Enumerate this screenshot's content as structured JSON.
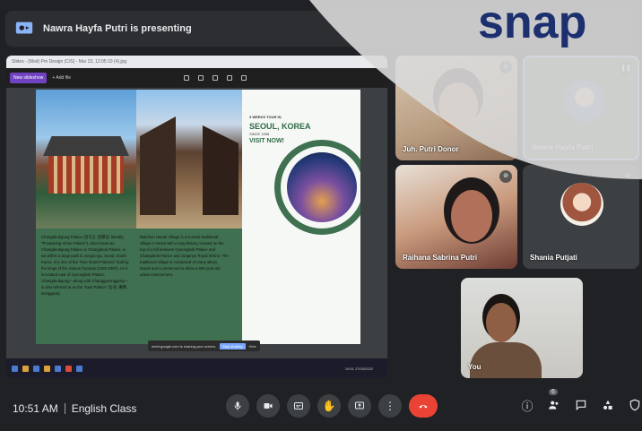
{
  "presenting_bar": {
    "text": "Nawra Hayfa Putri is presenting"
  },
  "shared_screen": {
    "window_title": "Slides - (Mod) Pro Design (C/S) - Mar 23, 12:05:10 (4).jpg",
    "toolbar_tab": "New slideshow",
    "toolbar_item": "+ Add file",
    "brochure": {
      "small_header": "3 WEEKS TOUR IN",
      "title": "SEOUL, KOREA",
      "subtitle": "SINCE 1998",
      "cta": "VISIT NOW!",
      "col1_text": "Changdeokgung Palace (창덕궁, 昌德宮; literally: \"Prospering Virtue Palace\"), also known as Changdeokgung Palace or Changdeok Palace, is set within a large park in Jongno-gu, Seoul, South Korea. It is one of the \"Five Grand Palaces\" built by the kings of the Joseon Dynasty (1392-1897). As it is located east of Gyeongbok Palace, Changdeokgung—along with Changgyeonggung—is also referred to as the \"East Palace\" (동궐, 東闕, Donggwol).",
      "col2_text": "Bukchon Hanok Village is a Korean traditional village in Seoul with a long history, located on the top of a hill between Gyeongbok Palace and Changdeok Palace and Jongmyo Royal Shrine. The traditional village is composed of many alleys, hanok and is preserved to show a 600-year-old urban environment."
    },
    "notice_text": "meet.google.com is sharing your screen.",
    "notice_stop": "Stop sharing",
    "notice_hide": "Hide",
    "taskbar_clock": "10:51 27/03/2022"
  },
  "participants": [
    {
      "name": "Juh. Putri Donor",
      "muted": true
    },
    {
      "name": "Nawra Hayfa Putri",
      "muted": false
    },
    {
      "name": "Raihana Sabrina Putri",
      "muted": true
    },
    {
      "name": "Shania Putjati",
      "muted": true
    },
    {
      "name": "You",
      "muted": false
    }
  ],
  "overlay": {
    "logo_text": "snap"
  },
  "bottom_bar": {
    "time": "10:51 AM",
    "meeting_name": "English Class",
    "people_count": "6"
  },
  "colors": {
    "background": "#202124",
    "end_call": "#ea4335",
    "active_speaker_border": "#8ab4f8",
    "brochure_green": "#3f7050",
    "logo_blue": "#1c2f6e"
  },
  "icons": {
    "mic": "mic-icon",
    "camera": "camera-icon",
    "captions": "captions-icon",
    "raise_hand": "raise-hand-icon",
    "present": "present-icon",
    "more": "more-options-icon",
    "end_call": "end-call-icon",
    "info": "info-icon",
    "people": "people-icon",
    "chat": "chat-icon",
    "activities": "activities-icon",
    "host_controls": "host-controls-icon"
  }
}
